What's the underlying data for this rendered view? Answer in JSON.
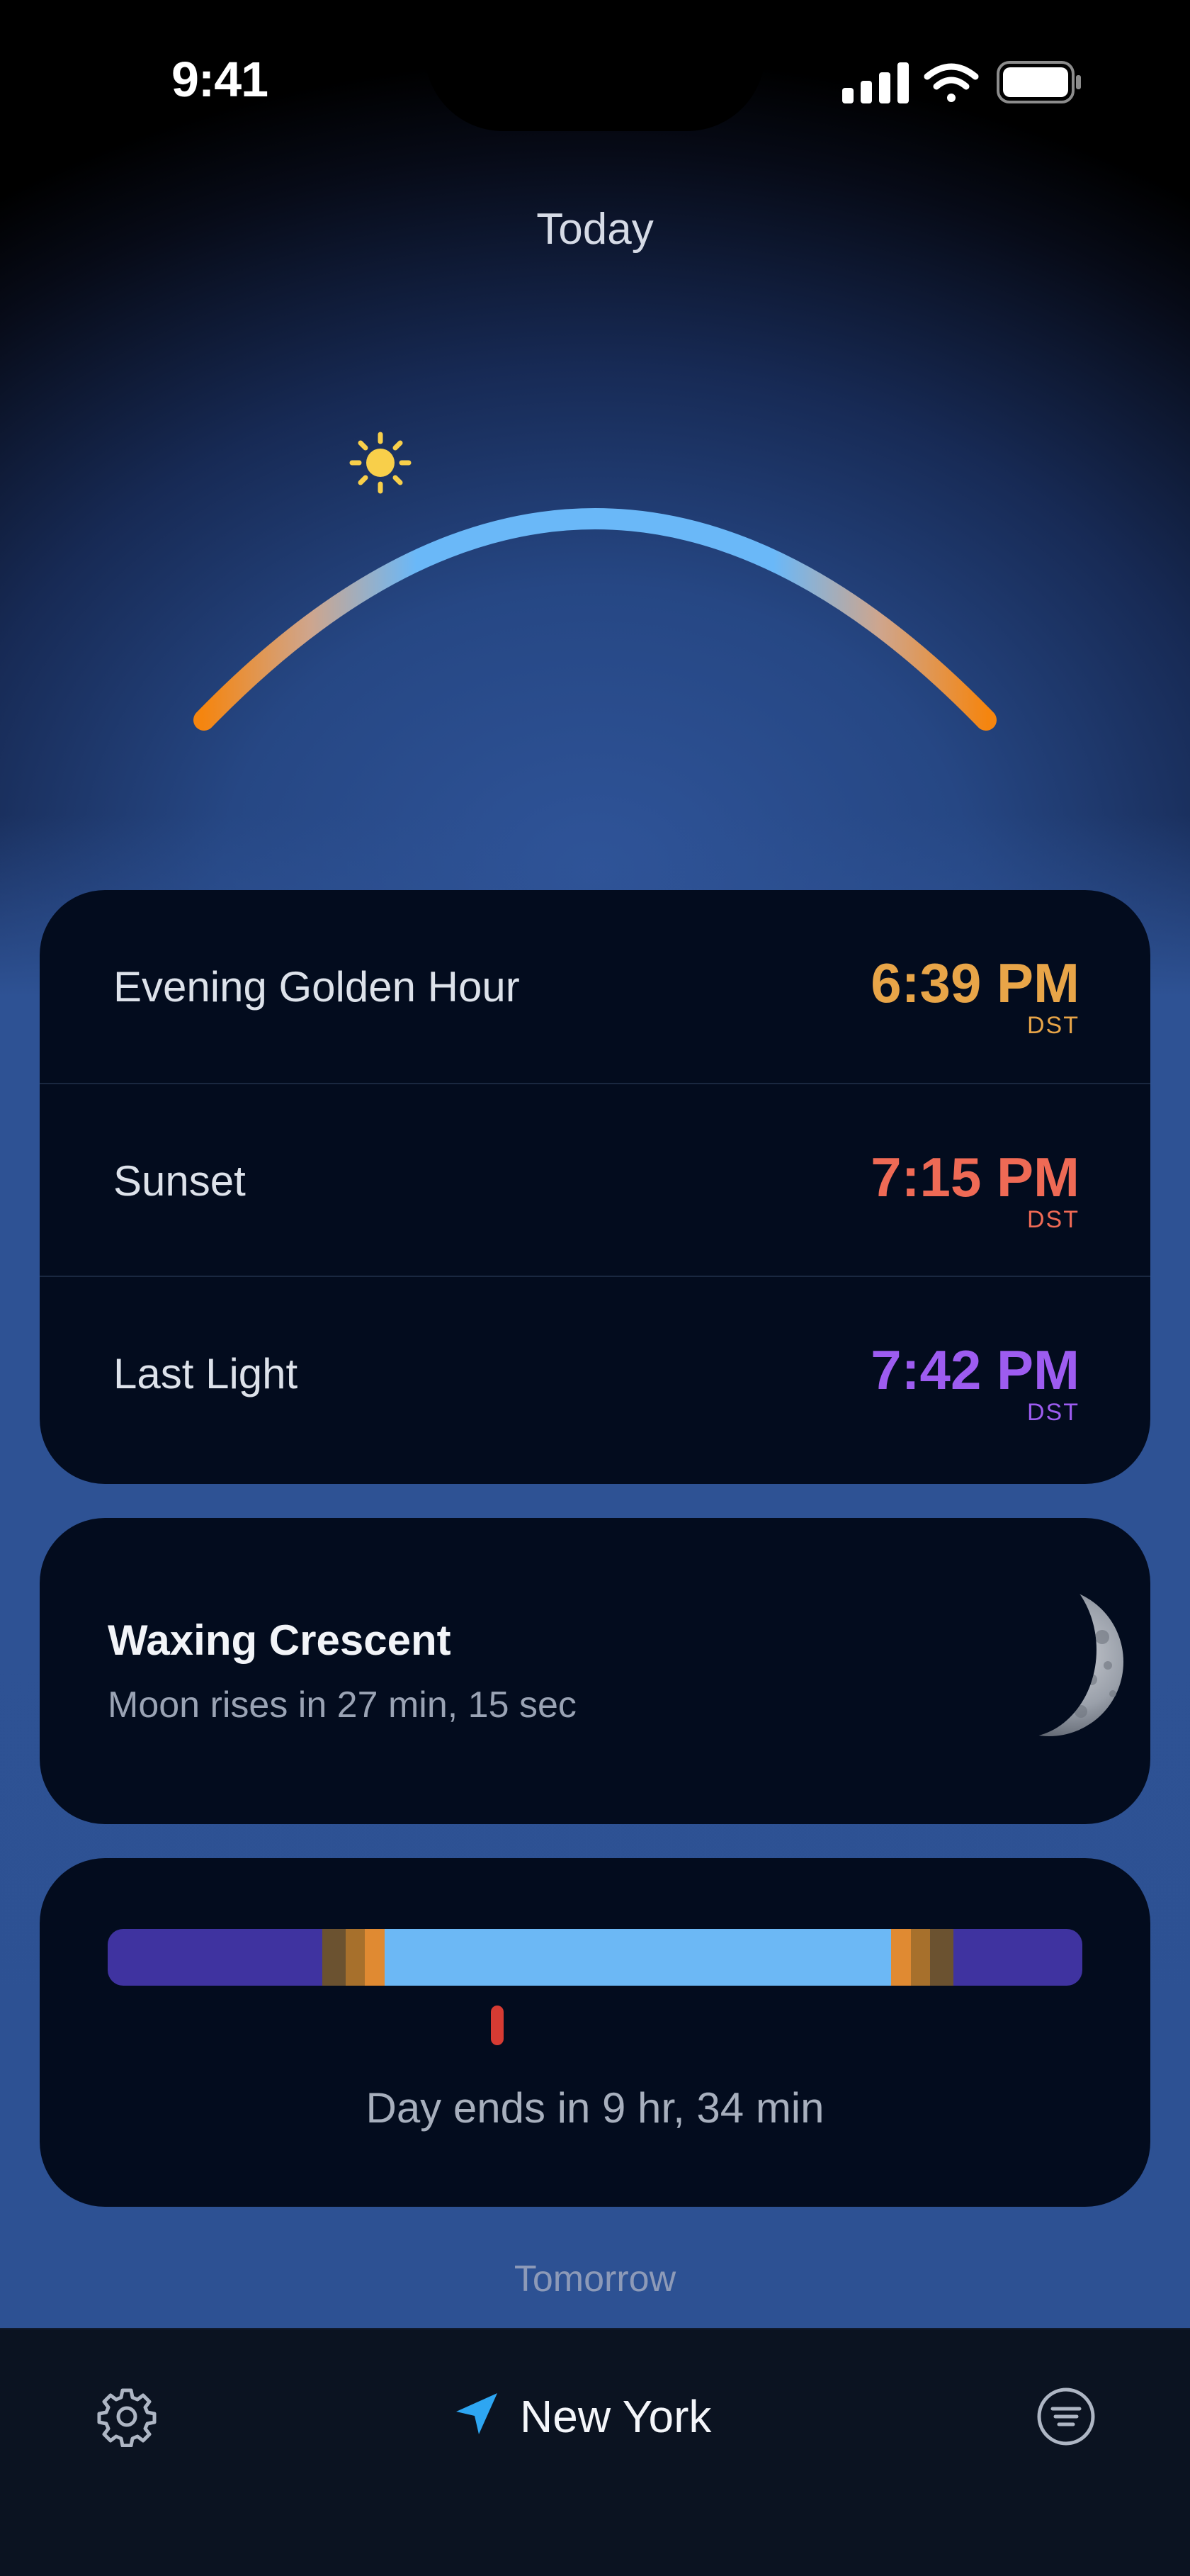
{
  "status_bar": {
    "time": "9:41",
    "icons": [
      "cellular-signal-icon",
      "wifi-icon",
      "battery-icon"
    ]
  },
  "header": {
    "title": "Today"
  },
  "sun_arc": {
    "icon": "sun-icon",
    "colors": {
      "horizon": "#f5850f",
      "sky": "#6ab8f8",
      "sun": "#f8cf4a"
    }
  },
  "times": [
    {
      "label": "Evening Golden Hour",
      "time": "6:39 PM",
      "zone": "DST",
      "color": "#e8a548"
    },
    {
      "label": "Sunset",
      "time": "7:15 PM",
      "zone": "DST",
      "color": "#ef6a55"
    },
    {
      "label": "Last Light",
      "time": "7:42 PM",
      "zone": "DST",
      "color": "#9d5cf0"
    }
  ],
  "moon": {
    "phase": "Waxing Crescent",
    "rise_text": "Moon rises in 27 min, 15 sec",
    "icon": "moon-crescent-icon"
  },
  "day_timeline": {
    "segments": [
      {
        "name": "night",
        "fraction": 0.22,
        "color": "#3f33a0"
      },
      {
        "name": "astronomical-twilight",
        "fraction": 0.024,
        "color": "#6b5230"
      },
      {
        "name": "civil-twilight",
        "fraction": 0.02,
        "color": "#a7702c"
      },
      {
        "name": "golden-hour",
        "fraction": 0.02,
        "color": "#e08a32"
      },
      {
        "name": "day",
        "fraction": 0.52,
        "color": "#6cb8f5"
      },
      {
        "name": "golden-hour",
        "fraction": 0.02,
        "color": "#e08a32"
      },
      {
        "name": "civil-twilight",
        "fraction": 0.02,
        "color": "#a7702c"
      },
      {
        "name": "astronomical-twilight",
        "fraction": 0.024,
        "color": "#6b5230"
      },
      {
        "name": "night",
        "fraction": 0.132,
        "color": "#3f33a0"
      }
    ],
    "now_fraction": 0.4,
    "now_color": "#d63b33",
    "day_ends_text": "Day ends in 9 hr, 34 min"
  },
  "next_section": {
    "label": "Tomorrow"
  },
  "tab_bar": {
    "settings_icon": "gear-icon",
    "location_icon": "location-arrow-icon",
    "location_name": "New York",
    "menu_icon": "filter-menu-icon",
    "accent": "#2ea6f2"
  }
}
